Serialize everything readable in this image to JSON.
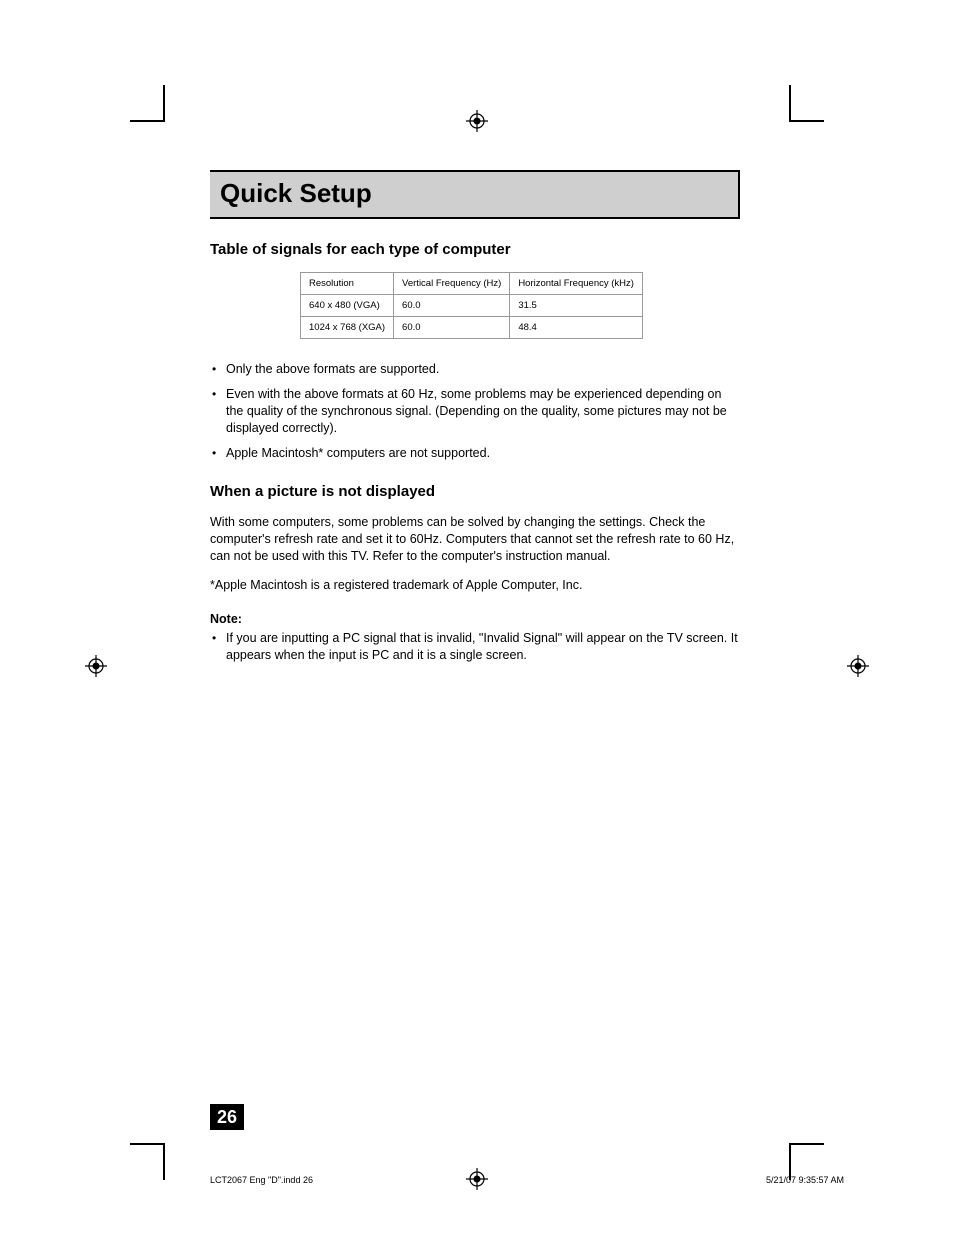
{
  "title": "Quick Setup",
  "section1_heading": "Table of signals for each type of computer",
  "table": {
    "headers": [
      "Resolution",
      "Vertical Frequency (Hz)",
      "Horizontal Frequency (kHz)"
    ],
    "rows": [
      [
        "640 x 480 (VGA)",
        "60.0",
        "31.5"
      ],
      [
        "1024 x 768 (XGA)",
        "60.0",
        "48.4"
      ]
    ]
  },
  "bullets_1": [
    "Only the above formats are supported.",
    "Even with the above formats at 60 Hz, some problems may be experienced depending on the quality of the synchronous signal.  (Depending on the quality, some pictures may not be displayed correctly).",
    "Apple Macintosh* computers are not supported."
  ],
  "section2_heading": "When a picture is not displayed",
  "section2_body": "With some computers, some problems can be solved by changing the settings.  Check the computer's refresh rate and set it to 60Hz.  Computers that cannot set the refresh rate to 60 Hz, can not be used with this TV.  Refer to the computer's instruction manual.",
  "trademark_note": "*Apple Macintosh is a registered trademark of Apple Computer, Inc.",
  "note_label": "Note:",
  "note_bullets": [
    "If you are inputting a PC signal that is invalid, \"Invalid Signal\" will appear on the TV screen.  It appears when the input is PC and it is a single screen."
  ],
  "page_number": "26",
  "footer_left": "LCT2067 Eng \"D\".indd   26",
  "footer_right": "5/21/07   9:35:57 AM"
}
